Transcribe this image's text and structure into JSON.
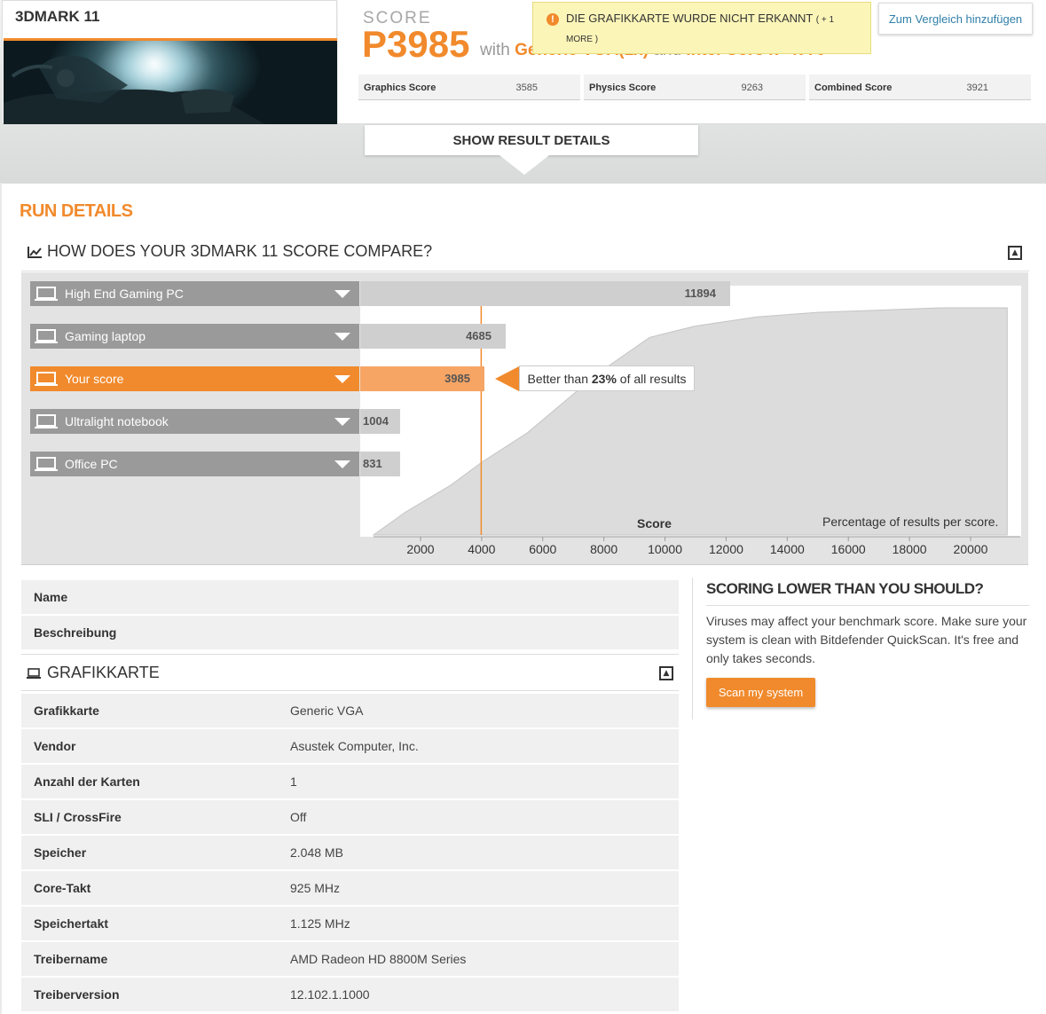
{
  "header": {
    "benchmark_title": "3DMARK 11",
    "score_caption": "SCORE",
    "score_value": "P3985",
    "score_with": "with",
    "gpu_name": "Generic VGA(1x)",
    "score_and": "and",
    "cpu_name": "Intel Core i7-4770",
    "warning_text": "DIE GRAFIKKARTE WURDE NICHT ERKANNT",
    "warning_extra": "( + 1",
    "warning_more": "MORE )",
    "compare_button": "Zum Vergleich hinzufügen",
    "subscores": [
      {
        "label": "Graphics Score",
        "value": "3585"
      },
      {
        "label": "Physics Score",
        "value": "9263"
      },
      {
        "label": "Combined Score",
        "value": "3921"
      }
    ],
    "show_details": "SHOW RESULT DETAILS"
  },
  "run_details_title": "RUN DETAILS",
  "compare": {
    "title": "HOW DOES YOUR 3DMARK 11 SCORE COMPARE?",
    "rows": [
      {
        "label": "High End Gaming PC",
        "value": 11894,
        "display": "11894",
        "active": false
      },
      {
        "label": "Gaming laptop",
        "value": 4685,
        "display": "4685",
        "active": false
      },
      {
        "label": "Your score",
        "value": 3985,
        "display": "3985",
        "active": true
      },
      {
        "label": "Ultralight notebook",
        "value": 1004,
        "display": "1004",
        "active": false
      },
      {
        "label": "Office PC",
        "value": 831,
        "display": "831",
        "active": false
      }
    ],
    "better_prefix": "Better than",
    "better_percent": "23%",
    "better_suffix": "of all results",
    "score_axis_label": "Score",
    "percentage_label": "Percentage of results per score.",
    "x_ticks": [
      "2000",
      "4000",
      "6000",
      "8000",
      "10000",
      "12000",
      "14000",
      "16000",
      "18000",
      "20000"
    ],
    "x_tick_values": [
      2000,
      4000,
      6000,
      8000,
      10000,
      12000,
      14000,
      16000,
      18000,
      20000
    ],
    "x_range": [
      0,
      21200
    ],
    "distribution_curve": [
      [
        0,
        0
      ],
      [
        1500,
        0.1
      ],
      [
        3000,
        0.22
      ],
      [
        4000,
        0.32
      ],
      [
        5500,
        0.45
      ],
      [
        7000,
        0.62
      ],
      [
        8000,
        0.73
      ],
      [
        9500,
        0.87
      ],
      [
        11000,
        0.92
      ],
      [
        13000,
        0.96
      ],
      [
        15000,
        0.98
      ],
      [
        17000,
        0.99
      ],
      [
        19000,
        1.0
      ],
      [
        21000,
        1.0
      ]
    ],
    "accent_color": "#f18a2c"
  },
  "info_rows": [
    {
      "label": "Name",
      "value": ""
    },
    {
      "label": "Beschreibung",
      "value": ""
    }
  ],
  "gpu_section": {
    "title": "GRAFIKKARTE",
    "rows": [
      {
        "label": "Grafikkarte",
        "value": "Generic VGA"
      },
      {
        "label": "Vendor",
        "value": "Asustek Computer, Inc."
      },
      {
        "label": "Anzahl der Karten",
        "value": "1"
      },
      {
        "label": "SLI / CrossFire",
        "value": "Off"
      },
      {
        "label": "Speicher",
        "value": "2.048 MB"
      },
      {
        "label": "Core-Takt",
        "value": "925 MHz"
      },
      {
        "label": "Speichertakt",
        "value": "1.125 MHz"
      },
      {
        "label": "Treibername",
        "value": "AMD Radeon HD 8800M Series"
      },
      {
        "label": "Treiberversion",
        "value": "12.102.1.1000"
      }
    ]
  },
  "aside": {
    "title": "SCORING LOWER THAN YOU SHOULD?",
    "text": "Viruses may affect your benchmark score. Make sure your system is clean with Bitdefender QuickScan. It's free and only takes seconds.",
    "button": "Scan my system"
  }
}
